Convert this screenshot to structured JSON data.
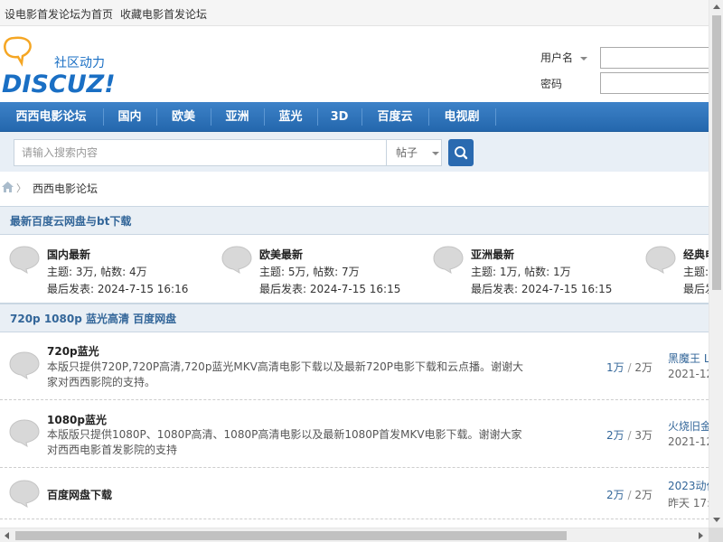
{
  "topbar": {
    "set_homepage": "设电影首发论坛为首页",
    "bookmark": "收藏电影首发论坛"
  },
  "logo": {
    "brand_text": "DISCUZ!",
    "slogan": "社区动力",
    "accent_orange": "#f5a623",
    "accent_blue": "#1a6fc4"
  },
  "login": {
    "username_label": "用户名",
    "password_label": "密码"
  },
  "nav": {
    "items": [
      {
        "label": "西西电影论坛"
      },
      {
        "label": "国内"
      },
      {
        "label": "欧美"
      },
      {
        "label": "亚洲"
      },
      {
        "label": "蓝光"
      },
      {
        "label": "3D"
      },
      {
        "label": "百度云"
      },
      {
        "label": "电视剧"
      }
    ]
  },
  "search": {
    "placeholder": "请输入搜索内容",
    "type_selected": "帖子",
    "button_icon": "search-icon"
  },
  "breadcrumb": {
    "home_icon": "home-icon",
    "separator": "〉",
    "current": "西西电影论坛"
  },
  "latest_section": {
    "title": "最新百度云网盘与bt下载",
    "topics_prefix": "主题: ",
    "posts_prefix": ", 帖数: ",
    "last_prefix": "最后发表: ",
    "cards": [
      {
        "title": "国内最新",
        "topics": "3万",
        "posts": "4万",
        "last_post": "2024-7-15 16:16"
      },
      {
        "title": "欧美最新",
        "topics": "5万",
        "posts": "7万",
        "last_post": "2024-7-15 16:15"
      },
      {
        "title": "亚洲最新",
        "topics": "1万",
        "posts": "1万",
        "last_post": "2024-7-15 16:15"
      },
      {
        "title": "经典电影",
        "topics": "",
        "posts": "",
        "last_post": ""
      }
    ]
  },
  "hd_section": {
    "title": "720p 1080p 蓝光高清 百度网盘",
    "forums": [
      {
        "name": "720p蓝光",
        "desc": "本版只提供720P,720P高清,720p蓝光MKV高清电影下载以及最新720P电影下载和云点播。谢谢大家对西西影院的支持。",
        "topics": "1万",
        "slash": "/",
        "posts": "2万",
        "last_title": "黑魔王 L",
        "last_time": "2021-12"
      },
      {
        "name": "1080p蓝光",
        "desc": "本版版只提供1080P、1080P高清、1080P高清电影以及最新1080P首发MKV电影下载。谢谢大家对西西电影首发影院的支持",
        "topics": "2万",
        "slash": "/",
        "posts": "3万",
        "last_title": "火烧旧金",
        "last_time": "2021-12"
      },
      {
        "name": "百度网盘下载",
        "desc": "",
        "topics": "2万",
        "slash": "/",
        "posts": "2万",
        "last_title": "2023动作",
        "last_time": "昨天 17:"
      }
    ]
  },
  "colors": {
    "nav_blue": "#2a6ab0",
    "section_bg": "#e9eff5",
    "link_blue": "#336699"
  }
}
